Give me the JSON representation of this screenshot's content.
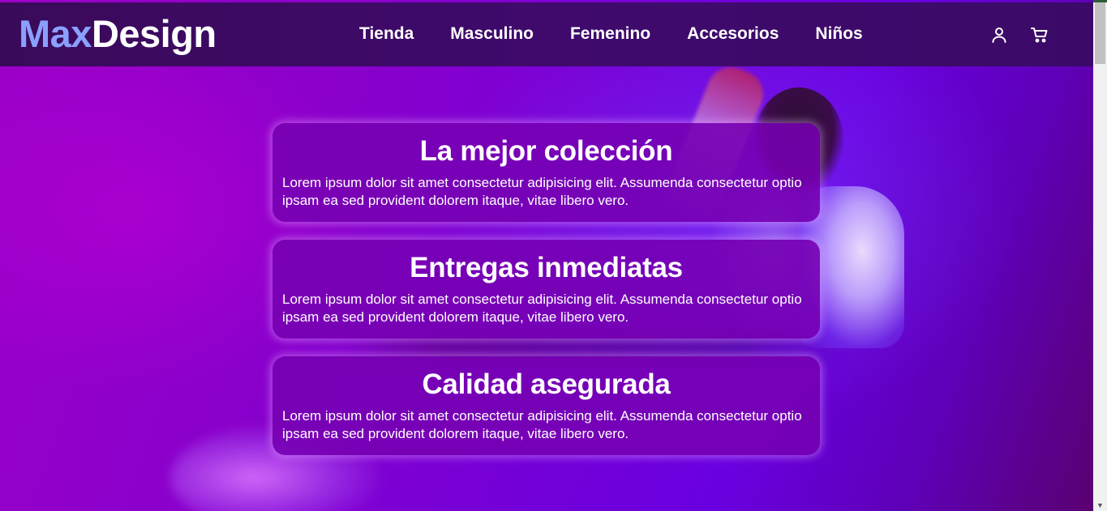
{
  "brand": {
    "part1": "Max",
    "part2": "Design",
    "accent_color": "#8aa0ff"
  },
  "nav": {
    "links": [
      "Tienda",
      "Masculino",
      "Femenino",
      "Accesorios",
      "Niños"
    ],
    "icons": [
      "user-icon",
      "cart-icon"
    ]
  },
  "cards": [
    {
      "title": "La mejor colección",
      "text": "Lorem ipsum dolor sit amet consectetur adipisicing elit. Assumenda consectetur optio ipsam ea sed provident dolorem itaque, vitae libero vero."
    },
    {
      "title": "Entregas inmediatas",
      "text": "Lorem ipsum dolor sit amet consectetur adipisicing elit. Assumenda consectetur optio ipsam ea sed provident dolorem itaque, vitae libero vero."
    },
    {
      "title": "Calidad asegurada",
      "text": "Lorem ipsum dolor sit amet consectetur adipisicing elit. Assumenda consectetur optio ipsam ea sed provident dolorem itaque, vitae libero vero."
    }
  ],
  "colors": {
    "navbar": "#3b0a68",
    "card": "#7600b2",
    "hero": "#8a00cc"
  }
}
